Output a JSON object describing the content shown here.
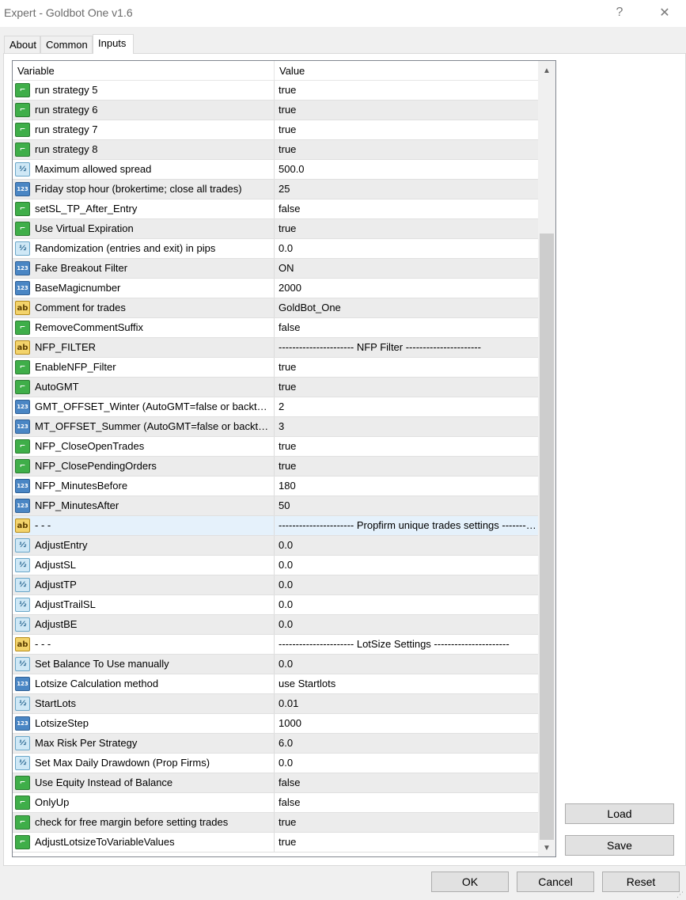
{
  "window": {
    "title": "Expert - Goldbot One v1.6",
    "help": "?",
    "close": "✕"
  },
  "tabs": [
    {
      "label": "About"
    },
    {
      "label": "Common"
    },
    {
      "label": "Inputs"
    }
  ],
  "grid": {
    "headers": {
      "variable": "Variable",
      "value": "Value"
    },
    "rows": [
      {
        "type": "bool",
        "icon": "bool-icon",
        "name": "run strategy 5",
        "value": "true"
      },
      {
        "type": "bool",
        "icon": "bool-icon",
        "name": "run strategy 6",
        "value": "true"
      },
      {
        "type": "bool",
        "icon": "bool-icon",
        "name": "run strategy 7",
        "value": "true"
      },
      {
        "type": "bool",
        "icon": "bool-icon",
        "name": "run strategy 8",
        "value": "true"
      },
      {
        "type": "double",
        "icon": "double-icon",
        "name": "Maximum allowed spread",
        "value": "500.0"
      },
      {
        "type": "int",
        "icon": "int-icon",
        "name": "Friday stop hour (brokertime; close all trades)",
        "value": "25"
      },
      {
        "type": "bool",
        "icon": "bool-icon",
        "name": "setSL_TP_After_Entry",
        "value": "false"
      },
      {
        "type": "bool",
        "icon": "bool-icon",
        "name": "Use Virtual Expiration",
        "value": "true"
      },
      {
        "type": "double",
        "icon": "double-icon",
        "name": "Randomization (entries and exit) in pips",
        "value": "0.0"
      },
      {
        "type": "int",
        "icon": "int-icon",
        "name": "Fake Breakout Filter",
        "value": "ON"
      },
      {
        "type": "int",
        "icon": "int-icon",
        "name": "BaseMagicnumber",
        "value": "2000"
      },
      {
        "type": "str",
        "icon": "string-icon",
        "name": "Comment for trades",
        "value": "GoldBot_One"
      },
      {
        "type": "bool",
        "icon": "bool-icon",
        "name": "RemoveCommentSuffix",
        "value": "false"
      },
      {
        "type": "str",
        "icon": "string-icon",
        "name": "NFP_FILTER",
        "value": "---------------------- NFP Filter ----------------------"
      },
      {
        "type": "bool",
        "icon": "bool-icon",
        "name": "EnableNFP_Filter",
        "value": "true"
      },
      {
        "type": "bool",
        "icon": "bool-icon",
        "name": "AutoGMT",
        "value": "true"
      },
      {
        "type": "int",
        "icon": "int-icon",
        "name": "GMT_OFFSET_Winter (AutoGMT=false or backtest)",
        "value": "2"
      },
      {
        "type": "int",
        "icon": "int-icon",
        "name": "MT_OFFSET_Summer (AutoGMT=false or backtest)",
        "value": "3"
      },
      {
        "type": "bool",
        "icon": "bool-icon",
        "name": "NFP_CloseOpenTrades",
        "value": "true"
      },
      {
        "type": "bool",
        "icon": "bool-icon",
        "name": "NFP_ClosePendingOrders",
        "value": "true"
      },
      {
        "type": "int",
        "icon": "int-icon",
        "name": "NFP_MinutesBefore",
        "value": "180"
      },
      {
        "type": "int",
        "icon": "int-icon",
        "name": "NFP_MinutesAfter",
        "value": "50"
      },
      {
        "type": "str",
        "icon": "string-icon",
        "name": "- - -",
        "value": "---------------------- Propfirm unique trades settings ----------------------"
      },
      {
        "type": "double",
        "icon": "double-icon",
        "name": "AdjustEntry",
        "value": "0.0"
      },
      {
        "type": "double",
        "icon": "double-icon",
        "name": "AdjustSL",
        "value": "0.0"
      },
      {
        "type": "double",
        "icon": "double-icon",
        "name": "AdjustTP",
        "value": "0.0"
      },
      {
        "type": "double",
        "icon": "double-icon",
        "name": "AdjustTrailSL",
        "value": "0.0"
      },
      {
        "type": "double",
        "icon": "double-icon",
        "name": "AdjustBE",
        "value": "0.0"
      },
      {
        "type": "str",
        "icon": "string-icon",
        "name": "- - -",
        "value": "---------------------- LotSize Settings ----------------------"
      },
      {
        "type": "double",
        "icon": "double-icon",
        "name": "Set Balance To Use manually",
        "value": "0.0"
      },
      {
        "type": "int",
        "icon": "int-icon",
        "name": "Lotsize Calculation method",
        "value": "use Startlots"
      },
      {
        "type": "double",
        "icon": "double-icon",
        "name": "StartLots",
        "value": "0.01"
      },
      {
        "type": "int",
        "icon": "int-icon",
        "name": "LotsizeStep",
        "value": "1000"
      },
      {
        "type": "double",
        "icon": "double-icon",
        "name": "Max Risk Per Strategy",
        "value": "6.0"
      },
      {
        "type": "double",
        "icon": "double-icon",
        "name": "Set Max Daily Drawdown (Prop Firms)",
        "value": "0.0"
      },
      {
        "type": "bool",
        "icon": "bool-icon",
        "name": "Use Equity Instead of Balance",
        "value": "false"
      },
      {
        "type": "bool",
        "icon": "bool-icon",
        "name": "OnlyUp",
        "value": "false"
      },
      {
        "type": "bool",
        "icon": "bool-icon",
        "name": "check for free margin before setting trades",
        "value": "true"
      },
      {
        "type": "bool",
        "icon": "bool-icon",
        "name": "AdjustLotsizeToVariableValues",
        "value": "true"
      }
    ],
    "selected_index": 22
  },
  "buttons": {
    "load": "Load",
    "save": "Save",
    "ok": "OK",
    "cancel": "Cancel",
    "reset": "Reset"
  },
  "icon_glyphs": {
    "bool": "⌐",
    "double": "½",
    "int": "123",
    "str": "ab"
  },
  "scroll_arrows": {
    "up": "▲",
    "down": "▼"
  }
}
